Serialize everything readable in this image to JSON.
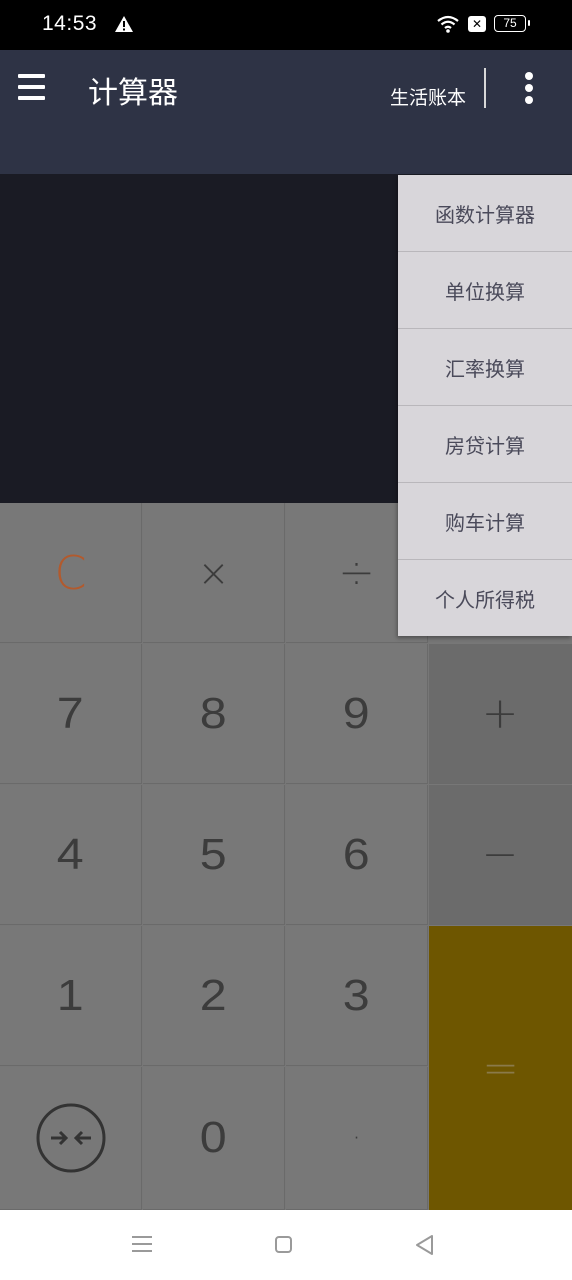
{
  "status_bar": {
    "time": "14:53",
    "battery": "75"
  },
  "app_bar": {
    "title": "计算器",
    "ledger_link": "生活账本"
  },
  "dropdown": {
    "items": [
      "函数计算器",
      "单位换算",
      "汇率换算",
      "房贷计算",
      "购车计算",
      "个人所得税"
    ]
  },
  "keypad": {
    "clear": "C",
    "multiply": "×",
    "divide": "÷",
    "plus": "+",
    "minus": "−",
    "equals": "=",
    "decimal": "·",
    "digits": [
      "0",
      "1",
      "2",
      "3",
      "4",
      "5",
      "6",
      "7",
      "8",
      "9"
    ]
  },
  "icons": {
    "menu": "hamburger-menu-icon",
    "more": "more-vertical-icon",
    "backspace": "collapse-arrows-icon",
    "status_warning": "warning-icon",
    "status_wifi": "wifi-icon",
    "status_nosim": "no-sim-icon"
  }
}
